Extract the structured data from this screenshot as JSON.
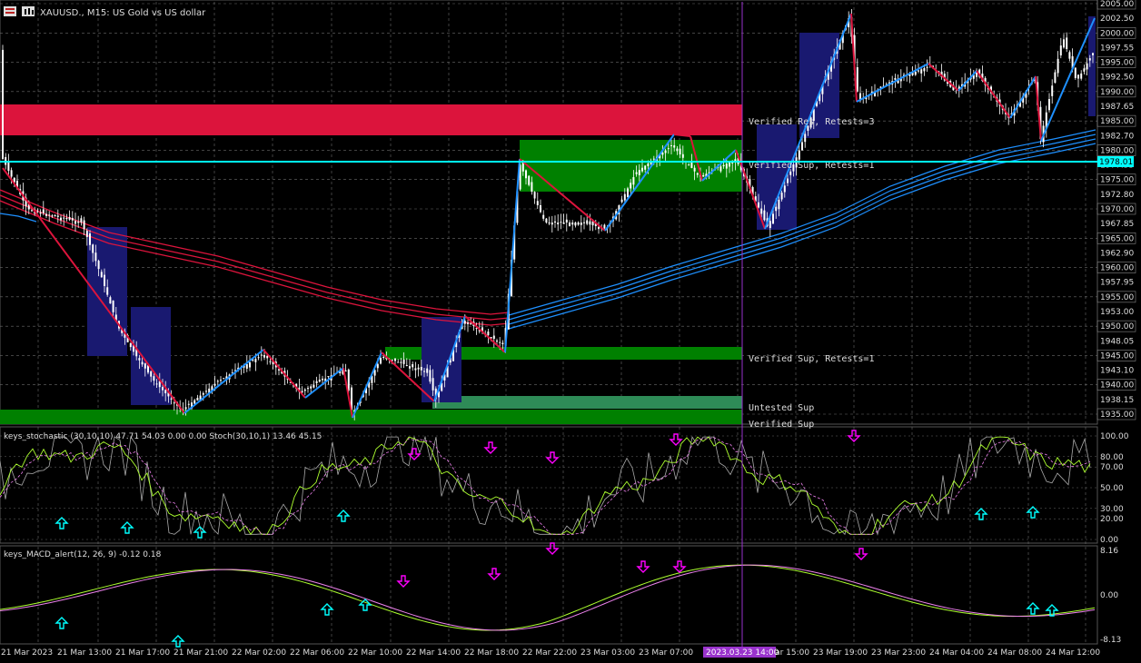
{
  "window": {
    "title": "XAUUSD., M15: US Gold vs US dollar"
  },
  "main_panel": {
    "price_axis": [
      "2005.00",
      "2002.50",
      "2000.00",
      "1997.55",
      "1995.00",
      "1992.50",
      "1990.00",
      "1987.65",
      "1985.00",
      "1982.70",
      "1980.00",
      "1977.55",
      "1975.00",
      "1972.80",
      "1970.00",
      "1967.85",
      "1965.00",
      "1962.90",
      "1960.00",
      "1957.95",
      "1955.00",
      "1953.00",
      "1950.00",
      "1948.05",
      "1945.00",
      "1943.10",
      "1940.00",
      "1938.15",
      "1935.00"
    ],
    "current_price": "1978.01",
    "zone_labels": [
      {
        "text": "Verified Res, Retests=3"
      },
      {
        "text": "Verified Sup, Retests=1"
      },
      {
        "text": "Verified Sup, Retests=1"
      },
      {
        "text": "Untested Sup"
      },
      {
        "text": "Verified Sup"
      }
    ]
  },
  "stochastic_panel": {
    "header": "keys_stochastic (30,10,10) 47.71 54.03 0.00 0.00 Stoch(30,10,1) 13.46 45.15",
    "axis": [
      "100.00",
      "80.00",
      "70.00",
      "50.00",
      "30.00",
      "20.00",
      "0.00"
    ]
  },
  "macd_panel": {
    "header": "keys_MACD_alert(12, 26, 9) -0.12 0.18",
    "axis": [
      "8.16",
      "0.00",
      "-8.13"
    ]
  },
  "time_axis": [
    "21 Mar 2023",
    "21 Mar 13:00",
    "21 Mar 17:00",
    "21 Mar 21:00",
    "22 Mar 02:00",
    "22 Mar 06:00",
    "22 Mar 10:00",
    "22 Mar 14:00",
    "22 Mar 18:00",
    "22 Mar 22:00",
    "23 Mar 03:00",
    "23 Mar 07:00",
    "2023.03.23 14:00",
    "23 Mar 15:00",
    "23 Mar 19:00",
    "23 Mar 23:00",
    "24 Mar 04:00",
    "24 Mar 08:00",
    "24 Mar 12:00"
  ],
  "colors": {
    "background": "#000000",
    "grid": "#6b6b6b",
    "resistance_zone": "#dc143c",
    "support_zone": "#008000",
    "untested_zone": "#2e8b57",
    "box_blue": "#191970",
    "ema_red": "#dc143c",
    "ema_blue": "#1e90ff",
    "price_line": "#00ffff",
    "signal_arrow_up": "#00ffff",
    "signal_arrow_down": "#ff00ff",
    "crosshair": "#9932cc"
  }
}
